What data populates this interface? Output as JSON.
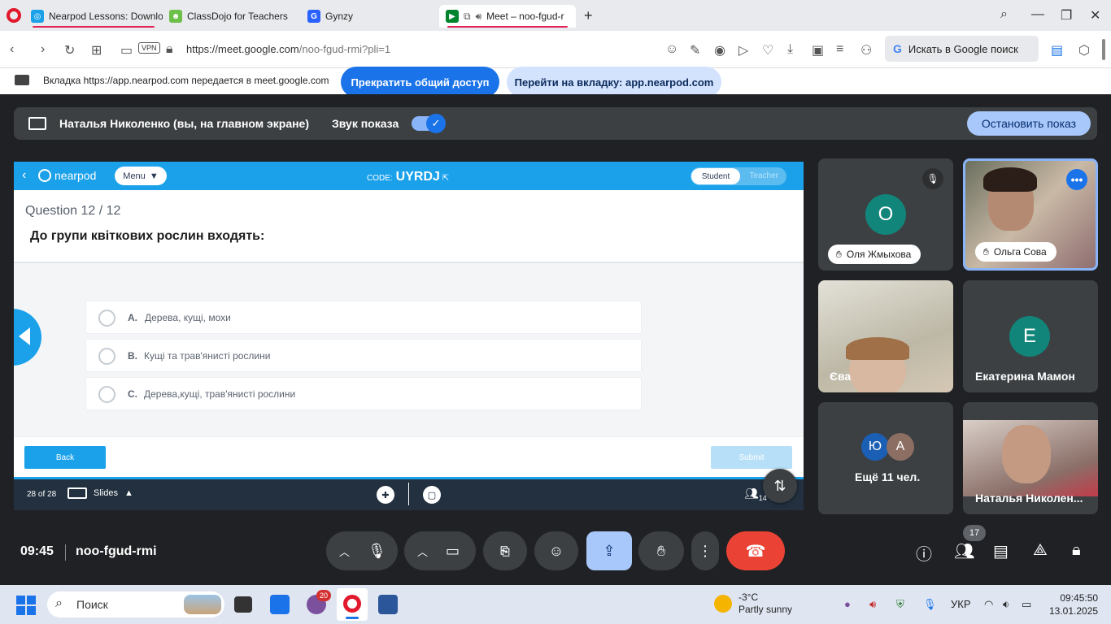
{
  "browser": {
    "tabs": [
      {
        "label": "Nearpod Lessons: Downlo",
        "color": "#1aa1ea"
      },
      {
        "label": "ClassDojo for Teachers",
        "color": "#6cc04a"
      },
      {
        "label": "Gynzy",
        "color": "#2962ff"
      },
      {
        "label": "Meet – noo-fgud-r",
        "color": "#00832d",
        "active": true
      }
    ],
    "url_host": "https://meet.google.com",
    "url_path": "/noo-fgud-rmi?pli=1",
    "vpn_label": "VPN",
    "search_label": "Искать в Google поиск"
  },
  "share_bar": {
    "text": "Вкладка https://app.nearpod.com передается в meet.google.com",
    "stop_label": "Прекратить общий доступ",
    "goto_label": "Перейти на вкладку: app.nearpod.com"
  },
  "presenting": {
    "name": "Наталья Николенко (вы, на главном экране)",
    "sound_label": "Звук показа",
    "stop_label": "Остановить показ"
  },
  "nearpod": {
    "logo": "nearpod",
    "menu_label": "Menu",
    "code_label": "CODE:",
    "code": "UYRDJ",
    "role_student": "Student",
    "role_teacher": "Teacher",
    "question_number": "Question 12 / 12",
    "question_text": "До групи квіткових рослин входять:",
    "options": [
      {
        "letter": "A.",
        "text": "Дерева, кущі, мохи"
      },
      {
        "letter": "B.",
        "text": "Кущі та трав'янисті рослини"
      },
      {
        "letter": "C.",
        "text": "Дерева,кущі, трав'янисті рослини"
      }
    ],
    "back_label": "Back",
    "submit_label": "Submit",
    "slide_count": "28 of 28",
    "slides_label": "Slides",
    "participants": "14"
  },
  "tiles": [
    {
      "name": "Оля Жмыхова",
      "initial": "О",
      "color": "#12857a"
    },
    {
      "name": "Ольга Сова"
    },
    {
      "name": "Єва"
    },
    {
      "name": "Екатерина Мамон",
      "initial": "Е",
      "color": "#12857a"
    },
    {
      "name": "Ещё 11 чел.",
      "initial1": "Ю",
      "color1": "#1a5fb4",
      "initial2": "А",
      "color2": "#8d6e63"
    },
    {
      "name": "Наталья Николен..."
    }
  ],
  "controls": {
    "time": "09:45",
    "meeting_code": "noo-fgud-rmi",
    "people_count": "17"
  },
  "taskbar": {
    "search_label": "Поиск",
    "viber_badge": "20",
    "temperature": "-3°C",
    "weather": "Partly sunny",
    "lang": "УКР",
    "clock_time": "09:45:50",
    "clock_date": "13.01.2025"
  }
}
